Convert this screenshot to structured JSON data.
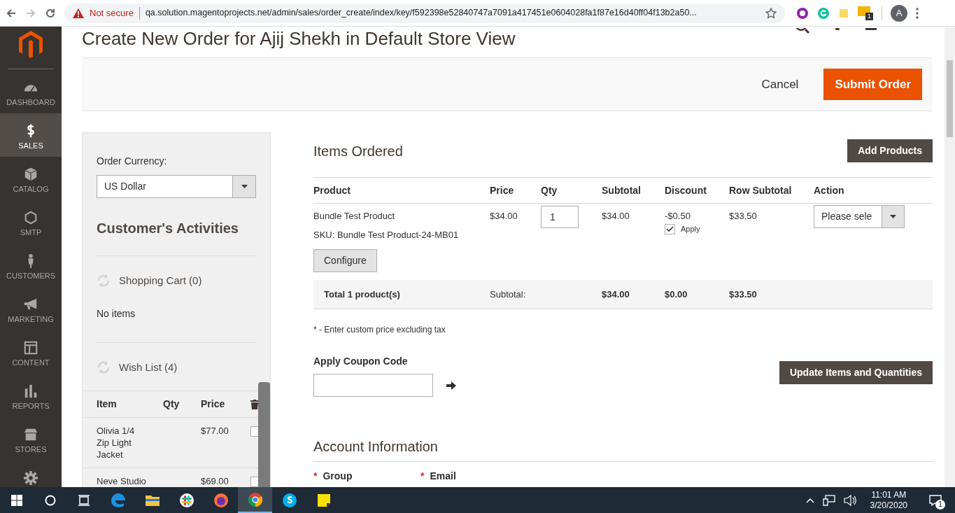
{
  "browser": {
    "security": "Not secure",
    "url": "qa.solution.magentoprojects.net/admin/sales/order_create/index/key/f592398e52840747a7091a417451e0604028fa1f87e16d40ff04f13b2a50...",
    "avatar": "A",
    "extension_badge": "1"
  },
  "sidebar": {
    "items": [
      {
        "label": "DASHBOARD",
        "selected": false
      },
      {
        "label": "SALES",
        "selected": true
      },
      {
        "label": "CATALOG",
        "selected": false
      },
      {
        "label": "SMTP",
        "selected": false
      },
      {
        "label": "CUSTOMERS",
        "selected": false
      },
      {
        "label": "MARKETING",
        "selected": false
      },
      {
        "label": "CONTENT",
        "selected": false
      },
      {
        "label": "REPORTS",
        "selected": false
      },
      {
        "label": "STORES",
        "selected": false
      },
      {
        "selected": false
      }
    ]
  },
  "page": {
    "title": "Create New Order for Ajij Shekh in Default Store View",
    "cancel": "Cancel",
    "submit": "Submit Order"
  },
  "side_panel": {
    "currency_label": "Order Currency:",
    "currency": "US Dollar",
    "activities_title": "Customer's Activities",
    "shopping_cart": {
      "title": "Shopping Cart (0)",
      "empty": "No items"
    },
    "wish_list": {
      "title": "Wish List (4)",
      "columns": [
        "Item",
        "Qty",
        "Price"
      ],
      "rows": [
        {
          "item": "Olivia 1/4 Zip Light Jacket",
          "price": "$77.00",
          "checked": false
        },
        {
          "item": "Neve Studio",
          "price": "$69.00",
          "checked": false
        }
      ]
    }
  },
  "items_ordered": {
    "title": "Items Ordered",
    "add_button": "Add Products",
    "columns": [
      "Product",
      "Price",
      "Qty",
      "Subtotal",
      "Discount",
      "Row Subtotal",
      "Action"
    ],
    "rows": [
      {
        "product": "Bundle Test Product",
        "sku": "SKU: Bundle Test Product-24-MB01",
        "configure": "Configure",
        "price": "$34.00",
        "qty": "1",
        "subtotal": "$34.00",
        "discount": "-$0.50",
        "apply_label": "Apply",
        "apply": true,
        "row_subtotal": "$33.50",
        "action": "Please sele"
      }
    ],
    "totals": {
      "label": "Total 1 product(s)",
      "subtotal_label": "Subtotal:",
      "subtotal": "$34.00",
      "discount": "$0.00",
      "row_subtotal": "$33.50"
    },
    "note": "* - Enter custom price excluding tax",
    "coupon_label": "Apply Coupon Code",
    "update_button": "Update Items and Quantities"
  },
  "account": {
    "title": "Account Information",
    "fields": [
      {
        "label": "Group",
        "required_mark": "*"
      },
      {
        "label": "Email",
        "required_mark": "*"
      }
    ]
  },
  "taskbar": {
    "apps": [
      {
        "selected": false
      },
      {
        "selected": false
      },
      {
        "selected": false
      },
      {
        "selected": false
      },
      {
        "selected": true
      },
      {
        "selected": false
      },
      {
        "selected": false
      }
    ],
    "time": "11:01 AM",
    "date": "3/20/2020",
    "notifications": "1"
  }
}
